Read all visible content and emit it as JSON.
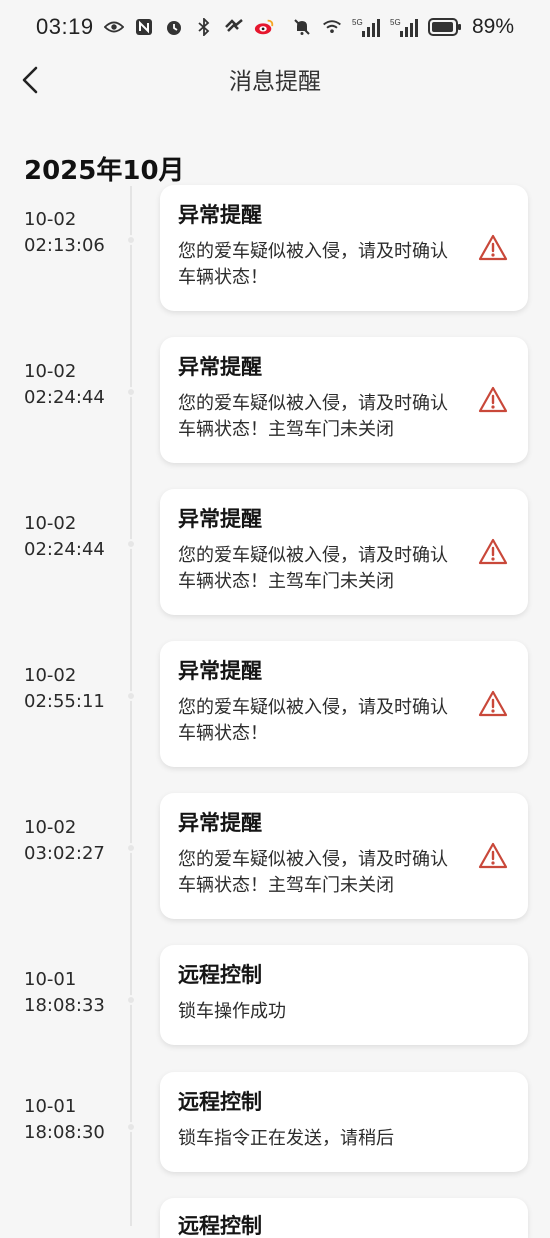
{
  "status_bar": {
    "time": "03:19",
    "battery": "89%",
    "icons_left": [
      "eye-icon",
      "nfc-icon",
      "alarm-icon",
      "bluetooth-icon",
      "heart-icon",
      "weibo-icon"
    ],
    "icons_right": [
      "mute-icon",
      "wifi-icon",
      "signal-5g-icon",
      "signal-5g-icon",
      "battery-icon"
    ],
    "signal_label": "5G"
  },
  "header": {
    "title": "消息提醒"
  },
  "month_label": "2025年10月",
  "colors": {
    "warning": "#c9483a",
    "card_bg": "#ffffff",
    "page_bg": "#f6f6f6"
  },
  "entries": [
    {
      "date": "10-02",
      "time": "02:13:06",
      "title": "异常提醒",
      "message": "您的爱车疑似被入侵，请及时确认车辆状态！",
      "warning": true
    },
    {
      "date": "10-02",
      "time": "02:24:44",
      "title": "异常提醒",
      "message": "您的爱车疑似被入侵，请及时确认车辆状态！主驾车门未关闭",
      "warning": true
    },
    {
      "date": "10-02",
      "time": "02:24:44",
      "title": "异常提醒",
      "message": "您的爱车疑似被入侵，请及时确认车辆状态！主驾车门未关闭",
      "warning": true
    },
    {
      "date": "10-02",
      "time": "02:55:11",
      "title": "异常提醒",
      "message": "您的爱车疑似被入侵，请及时确认车辆状态！",
      "warning": true
    },
    {
      "date": "10-02",
      "time": "03:02:27",
      "title": "异常提醒",
      "message": "您的爱车疑似被入侵，请及时确认车辆状态！主驾车门未关闭",
      "warning": true
    },
    {
      "date": "10-01",
      "time": "18:08:33",
      "title": "远程控制",
      "message": "锁车操作成功",
      "warning": false
    },
    {
      "date": "10-01",
      "time": "18:08:30",
      "title": "远程控制",
      "message": "锁车指令正在发送，请稍后",
      "warning": false
    }
  ],
  "peek_entry": {
    "title": "远程控制"
  }
}
